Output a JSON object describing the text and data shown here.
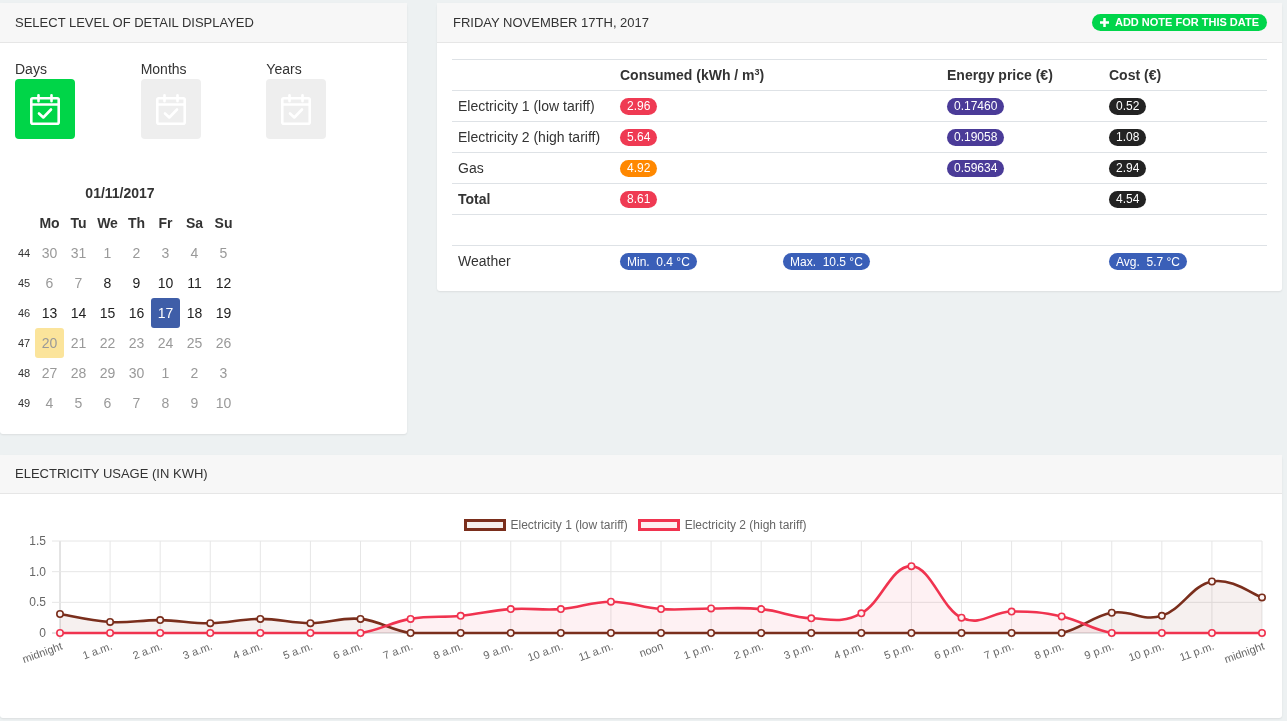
{
  "detail_panel": {
    "title": "SELECT LEVEL OF DETAIL DISPLAYED",
    "levels": [
      {
        "label": "Days",
        "selected": true
      },
      {
        "label": "Months",
        "selected": false
      },
      {
        "label": "Years",
        "selected": false
      }
    ],
    "calendar": {
      "title": "01/11/2017",
      "weekdays": [
        "Mo",
        "Tu",
        "We",
        "Th",
        "Fr",
        "Sa",
        "Su"
      ],
      "weeks": [
        {
          "number": "44",
          "days": [
            {
              "label": "30",
              "disabled": true,
              "selected": false,
              "today": false
            },
            {
              "label": "31",
              "disabled": true,
              "selected": false,
              "today": false
            },
            {
              "label": "1",
              "disabled": true,
              "selected": false,
              "today": false
            },
            {
              "label": "2",
              "disabled": true,
              "selected": false,
              "today": false
            },
            {
              "label": "3",
              "disabled": true,
              "selected": false,
              "today": false
            },
            {
              "label": "4",
              "disabled": true,
              "selected": false,
              "today": false
            },
            {
              "label": "5",
              "disabled": true,
              "selected": false,
              "today": false
            }
          ]
        },
        {
          "number": "45",
          "days": [
            {
              "label": "6",
              "disabled": true,
              "selected": false,
              "today": false
            },
            {
              "label": "7",
              "disabled": true,
              "selected": false,
              "today": false
            },
            {
              "label": "8",
              "disabled": false,
              "selected": false,
              "today": false
            },
            {
              "label": "9",
              "disabled": false,
              "selected": false,
              "today": false
            },
            {
              "label": "10",
              "disabled": false,
              "selected": false,
              "today": false
            },
            {
              "label": "11",
              "disabled": false,
              "selected": false,
              "today": false
            },
            {
              "label": "12",
              "disabled": false,
              "selected": false,
              "today": false
            }
          ]
        },
        {
          "number": "46",
          "days": [
            {
              "label": "13",
              "disabled": false,
              "selected": false,
              "today": false
            },
            {
              "label": "14",
              "disabled": false,
              "selected": false,
              "today": false
            },
            {
              "label": "15",
              "disabled": false,
              "selected": false,
              "today": false
            },
            {
              "label": "16",
              "disabled": false,
              "selected": false,
              "today": false
            },
            {
              "label": "17",
              "disabled": false,
              "selected": true,
              "today": false
            },
            {
              "label": "18",
              "disabled": false,
              "selected": false,
              "today": false
            },
            {
              "label": "19",
              "disabled": false,
              "selected": false,
              "today": false
            }
          ]
        },
        {
          "number": "47",
          "days": [
            {
              "label": "20",
              "disabled": true,
              "selected": false,
              "today": true
            },
            {
              "label": "21",
              "disabled": true,
              "selected": false,
              "today": false
            },
            {
              "label": "22",
              "disabled": true,
              "selected": false,
              "today": false
            },
            {
              "label": "23",
              "disabled": true,
              "selected": false,
              "today": false
            },
            {
              "label": "24",
              "disabled": true,
              "selected": false,
              "today": false
            },
            {
              "label": "25",
              "disabled": true,
              "selected": false,
              "today": false
            },
            {
              "label": "26",
              "disabled": true,
              "selected": false,
              "today": false
            }
          ]
        },
        {
          "number": "48",
          "days": [
            {
              "label": "27",
              "disabled": true,
              "selected": false,
              "today": false
            },
            {
              "label": "28",
              "disabled": true,
              "selected": false,
              "today": false
            },
            {
              "label": "29",
              "disabled": true,
              "selected": false,
              "today": false
            },
            {
              "label": "30",
              "disabled": true,
              "selected": false,
              "today": false
            },
            {
              "label": "1",
              "disabled": true,
              "selected": false,
              "today": false
            },
            {
              "label": "2",
              "disabled": true,
              "selected": false,
              "today": false
            },
            {
              "label": "3",
              "disabled": true,
              "selected": false,
              "today": false
            }
          ]
        },
        {
          "number": "49",
          "days": [
            {
              "label": "4",
              "disabled": true,
              "selected": false,
              "today": false
            },
            {
              "label": "5",
              "disabled": true,
              "selected": false,
              "today": false
            },
            {
              "label": "6",
              "disabled": true,
              "selected": false,
              "today": false
            },
            {
              "label": "7",
              "disabled": true,
              "selected": false,
              "today": false
            },
            {
              "label": "8",
              "disabled": true,
              "selected": false,
              "today": false
            },
            {
              "label": "9",
              "disabled": true,
              "selected": false,
              "today": false
            },
            {
              "label": "10",
              "disabled": true,
              "selected": false,
              "today": false
            }
          ]
        }
      ]
    }
  },
  "day_panel": {
    "title": "FRIDAY NOVEMBER 17TH, 2017",
    "add_note_button": "ADD NOTE FOR THIS DATE",
    "columns": [
      "Consumed (kWh / m$^{3}$)",
      "Energy price (€)",
      "Cost (€)"
    ],
    "rows": [
      {
        "label": "Electricity 1 (low tariff)",
        "kind": "item",
        "consumed": {
          "value": "2.96",
          "color": "#ef3a53"
        },
        "price": "0.17460",
        "cost": "0.52"
      },
      {
        "label": "Electricity 2 (high tariff)",
        "kind": "item",
        "consumed": {
          "value": "5.64",
          "color": "#ef3a53"
        },
        "price": "0.19058",
        "cost": "1.08"
      },
      {
        "label": "Gas",
        "kind": "item",
        "consumed": {
          "value": "4.92",
          "color": "#ff8800"
        },
        "price": "0.59634",
        "cost": "2.94"
      },
      {
        "label": "Total",
        "kind": "total",
        "consumed": {
          "value": "8.61",
          "color": "#ef3a53"
        },
        "cost": "4.54"
      }
    ],
    "weather": {
      "label": "Weather",
      "min": "Min.  0.4 °C",
      "max": "Max.  10.5 °C",
      "avg": "Avg.  5.7 °C"
    }
  },
  "usage_panel": {
    "title": "ELECTRICITY USAGE (IN KWH)",
    "chart_data": {
      "type": "area",
      "grid": true,
      "legend": "top",
      "categories": [
        "midnight",
        "1 a.m.",
        "2 a.m.",
        "3 a.m.",
        "4 a.m.",
        "5 a.m.",
        "6 a.m.",
        "7 a.m.",
        "8 a.m.",
        "9 a.m.",
        "10 a.m.",
        "11 a.m.",
        "noon",
        "1 p.m.",
        "2 p.m.",
        "3 p.m.",
        "4 p.m.",
        "5 p.m.",
        "6 p.m.",
        "7 p.m.",
        "8 p.m.",
        "9 p.m.",
        "10 p.m.",
        "11 p.m.",
        "midnight"
      ],
      "ylim": [
        0,
        1.5
      ],
      "yticks": [
        0,
        {
          "value": 0.5,
          "label": "0.5"
        },
        {
          "value": 1,
          "label": "1.0"
        },
        {
          "value": 1.5,
          "label": "1.5"
        }
      ],
      "series": [
        {
          "name": "Electricity 1 (low tariff)",
          "color": "#7a2e1c",
          "marker": true,
          "values": [
            0.31,
            0.18,
            0.21,
            0.16,
            0.23,
            0.16,
            0.23,
            0,
            0,
            0,
            0,
            0,
            0,
            0,
            0,
            0,
            0,
            0,
            0,
            0,
            0,
            0.33,
            0.28,
            0.84,
            0.58
          ]
        },
        {
          "name": "Electricity 2 (high tariff)",
          "color": "#f0334f",
          "marker": true,
          "values": [
            0,
            0,
            0,
            0,
            0,
            0,
            0,
            0.23,
            0.28,
            0.39,
            0.39,
            0.51,
            0.39,
            0.4,
            0.39,
            0.24,
            0.32,
            1.09,
            0.25,
            0.35,
            0.27,
            0,
            0,
            0,
            0
          ]
        }
      ]
    }
  }
}
